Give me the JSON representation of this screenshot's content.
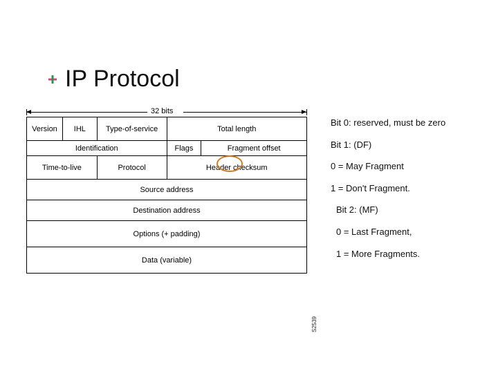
{
  "title": "IP Protocol",
  "bits_label": "32 bits",
  "header": {
    "row1": {
      "version": "Version",
      "ihl": "IHL",
      "tos": "Type-of-service",
      "total_length": "Total length"
    },
    "row2": {
      "identification": "Identification",
      "flags": "Flags",
      "fragment_offset": "Fragment offset"
    },
    "row3": {
      "ttl": "Time-to-live",
      "protocol": "Protocol",
      "checksum": "Header checksum"
    },
    "row4": {
      "source": "Source address"
    },
    "row5": {
      "dest": "Destination address"
    },
    "row6": {
      "options": "Options (+ padding)"
    },
    "row7": {
      "data": "Data (variable)"
    }
  },
  "notes": {
    "n0": "Bit 0: reserved, must be zero",
    "n1": "Bit 1: (DF)",
    "n2": "0 = May Fragment",
    "n3": "1 = Don't Fragment.",
    "n4": "Bit 2: (MF)",
    "n5": "0 = Last Fragment,",
    "n6": "1 = More Fragments."
  },
  "side_id": "S2539"
}
